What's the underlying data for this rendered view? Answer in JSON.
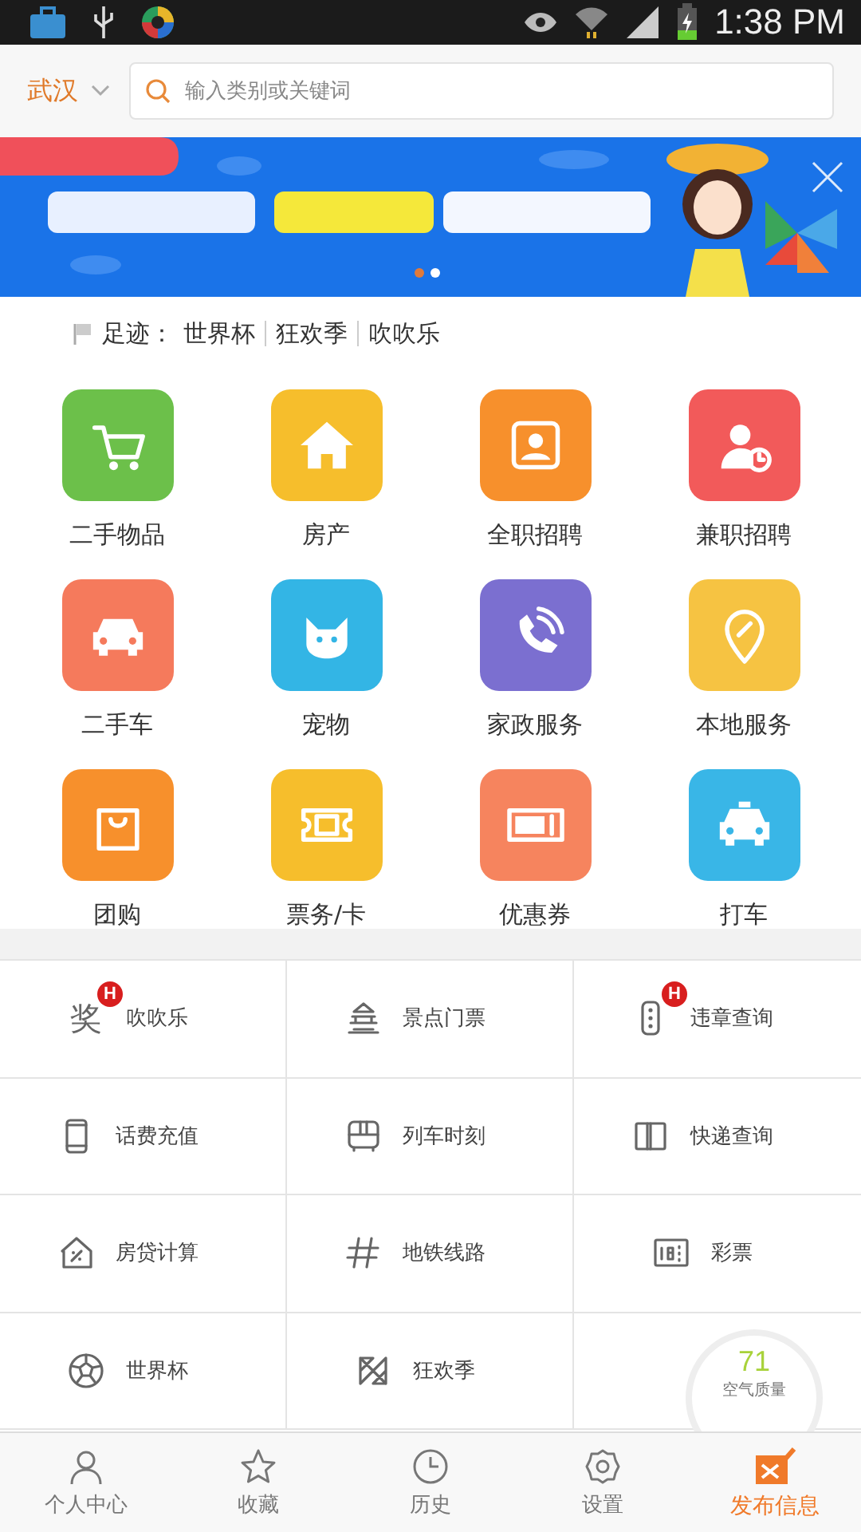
{
  "status_bar": {
    "time": "1:38 PM"
  },
  "header": {
    "city": "武汉",
    "search": {
      "placeholder": "输入类别或关键词"
    }
  },
  "banner": {
    "dots": [
      {
        "selected": true
      },
      {
        "selected": false
      }
    ]
  },
  "footprint": {
    "label": "足迹：",
    "items": [
      "世界杯",
      "狂欢季",
      "吹吹乐"
    ]
  },
  "categories": [
    {
      "label": "二手物品",
      "color": "#6cc04a"
    },
    {
      "label": "房产",
      "color": "#f6be2c"
    },
    {
      "label": "全职招聘",
      "color": "#f7902c"
    },
    {
      "label": "兼职招聘",
      "color": "#f25a5a"
    },
    {
      "label": "二手车",
      "color": "#f57a5c"
    },
    {
      "label": "宠物",
      "color": "#33b5e5"
    },
    {
      "label": "家政服务",
      "color": "#7b6fd0"
    },
    {
      "label": "本地服务",
      "color": "#f6c342"
    },
    {
      "label": "团购",
      "color": "#f7902c"
    },
    {
      "label": "票务/卡",
      "color": "#f6be2c"
    },
    {
      "label": "优惠券",
      "color": "#f6845e"
    },
    {
      "label": "打车",
      "color": "#39b6e7"
    }
  ],
  "services": [
    {
      "label": "吹吹乐",
      "glyph": "奖",
      "badge": "H"
    },
    {
      "label": "景点门票"
    },
    {
      "label": "违章查询",
      "badge": "H"
    },
    {
      "label": "话费充值"
    },
    {
      "label": "列车时刻"
    },
    {
      "label": "快递查询"
    },
    {
      "label": "房贷计算"
    },
    {
      "label": "地铁线路"
    },
    {
      "label": "彩票"
    },
    {
      "label": "世界杯"
    },
    {
      "label": "狂欢季"
    }
  ],
  "air_gauge": {
    "value": "71",
    "label": "空气质量"
  },
  "bottom_nav": [
    {
      "label": "个人中心",
      "kind": "tab"
    },
    {
      "label": "收藏",
      "kind": "tab"
    },
    {
      "label": "历史",
      "kind": "tab"
    },
    {
      "label": "设置",
      "kind": "tab"
    },
    {
      "label": "发布信息",
      "kind": "publish"
    }
  ]
}
